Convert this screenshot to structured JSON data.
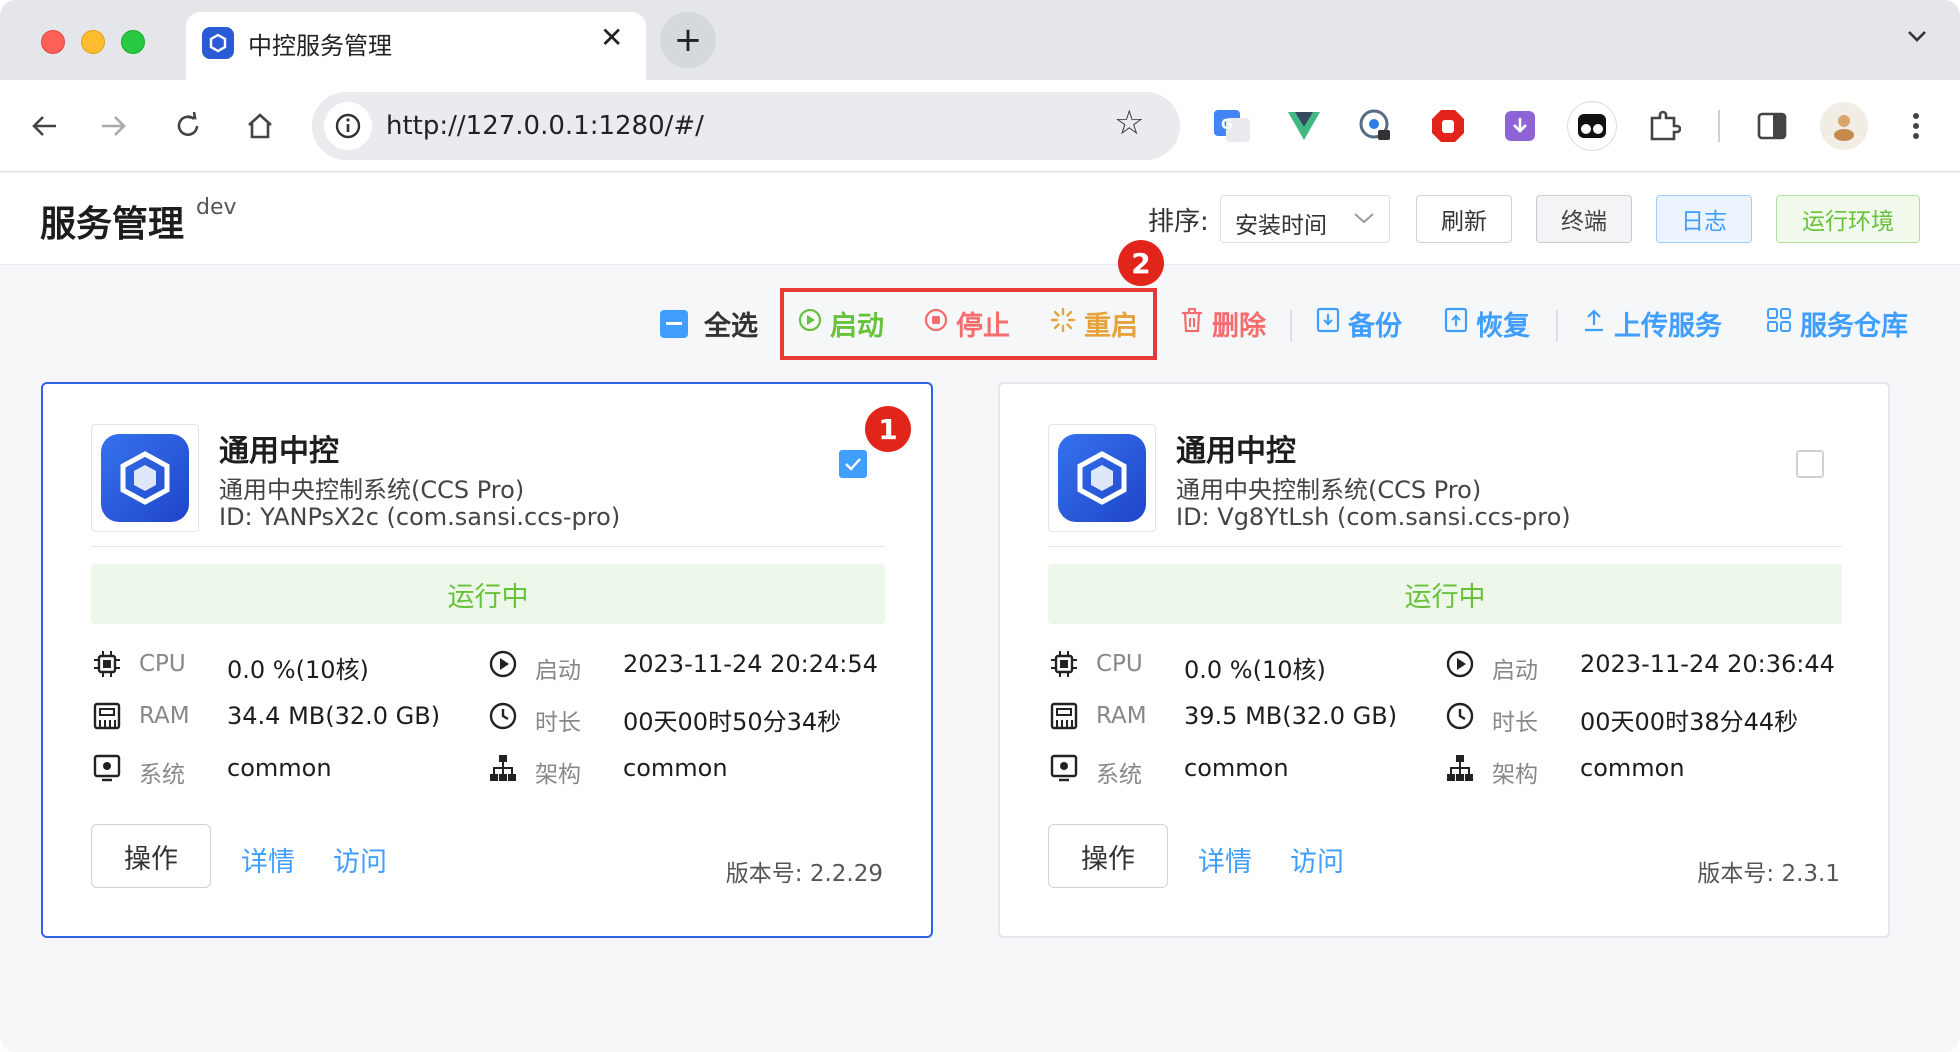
{
  "browser": {
    "tab_title": "中控服务管理",
    "tab_close": "✕",
    "new_tab": "+",
    "url": "http://127.0.0.1:1280/#/"
  },
  "header": {
    "title": "服务管理",
    "env": "dev",
    "sort_label": "排序:",
    "sort_value": "安装时间",
    "refresh": "刷新",
    "terminal": "终端",
    "log": "日志",
    "runtime_env": "运行环境"
  },
  "actions": {
    "select_all": "全选",
    "start": "启动",
    "stop": "停止",
    "restart": "重启",
    "delete": "删除",
    "backup": "备份",
    "restore": "恢复",
    "upload": "上传服务",
    "repository": "服务仓库"
  },
  "badges": [
    "1",
    "2"
  ],
  "colors": {
    "accent": "#409eff",
    "start": "#67c23a",
    "stop": "#f56c6c",
    "restart": "#e6a23c",
    "highlight": "#e53b36"
  },
  "cards": [
    {
      "name": "通用中控",
      "desc": "通用中央控制系统(CCS Pro)",
      "id": "ID: YANPsX2c (com.sansi.ccs-pro)",
      "selected": true,
      "status": "运行中",
      "metrics": {
        "cpu_label": "CPU",
        "cpu": "0.0 %(10核)",
        "ram_label": "RAM",
        "ram": "34.4 MB(32.0 GB)",
        "os_label": "系统",
        "os": "common",
        "start_label": "启动",
        "start": "2023-11-24 20:24:54",
        "uptime_label": "时长",
        "uptime": "00天00时50分34秒",
        "arch_label": "架构",
        "arch": "common"
      },
      "op": "操作",
      "detail": "详情",
      "visit": "访问",
      "version": "版本号: 2.2.29"
    },
    {
      "name": "通用中控",
      "desc": "通用中央控制系统(CCS Pro)",
      "id": "ID: Vg8YtLsh (com.sansi.ccs-pro)",
      "selected": false,
      "status": "运行中",
      "metrics": {
        "cpu_label": "CPU",
        "cpu": "0.0 %(10核)",
        "ram_label": "RAM",
        "ram": "39.5 MB(32.0 GB)",
        "os_label": "系统",
        "os": "common",
        "start_label": "启动",
        "start": "2023-11-24 20:36:44",
        "uptime_label": "时长",
        "uptime": "00天00时38分44秒",
        "arch_label": "架构",
        "arch": "common"
      },
      "op": "操作",
      "detail": "详情",
      "visit": "访问",
      "version": "版本号: 2.3.1"
    }
  ]
}
